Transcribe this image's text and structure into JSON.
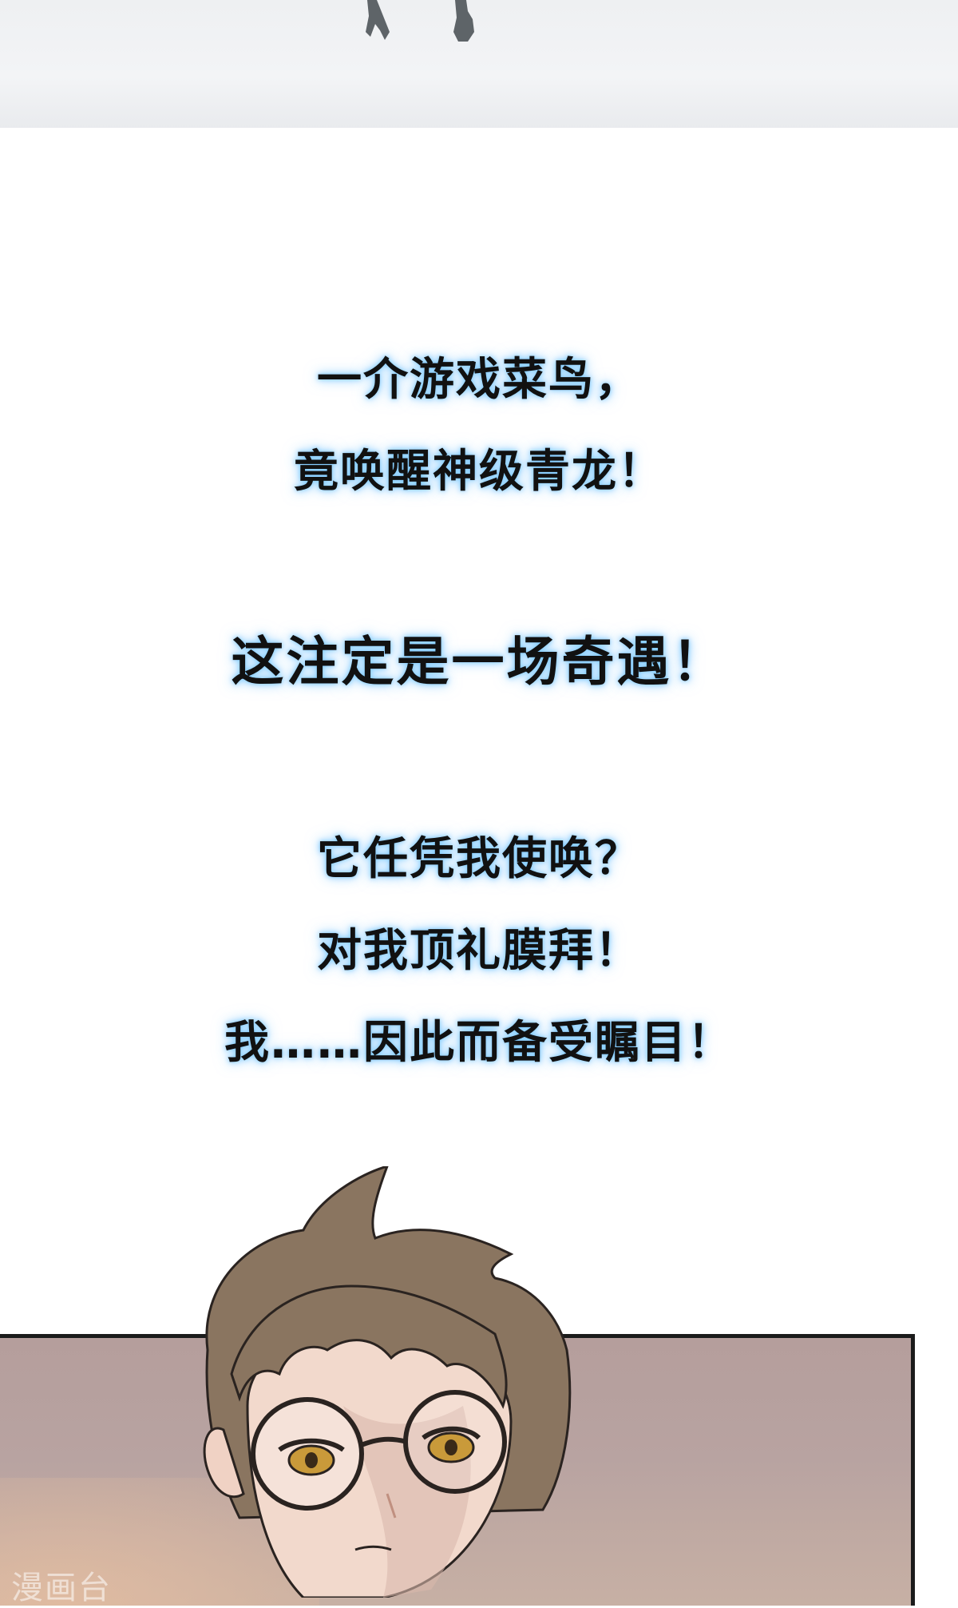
{
  "captions": {
    "line1": "一介游戏菜鸟，",
    "line2": "竟唤醒神级青龙！",
    "line3": "这注定是一场奇遇！",
    "line4": "它任凭我使唤？",
    "line5": "对我顶礼膜拜！",
    "line6": "我……因此而备受瞩目！"
  },
  "watermark": "漫画台",
  "colors": {
    "text": "#111111",
    "glow": "#78c8ff",
    "panel_bg": "#b8a3a1",
    "hair": "#8a7560",
    "eyes": "#c99a3a"
  }
}
